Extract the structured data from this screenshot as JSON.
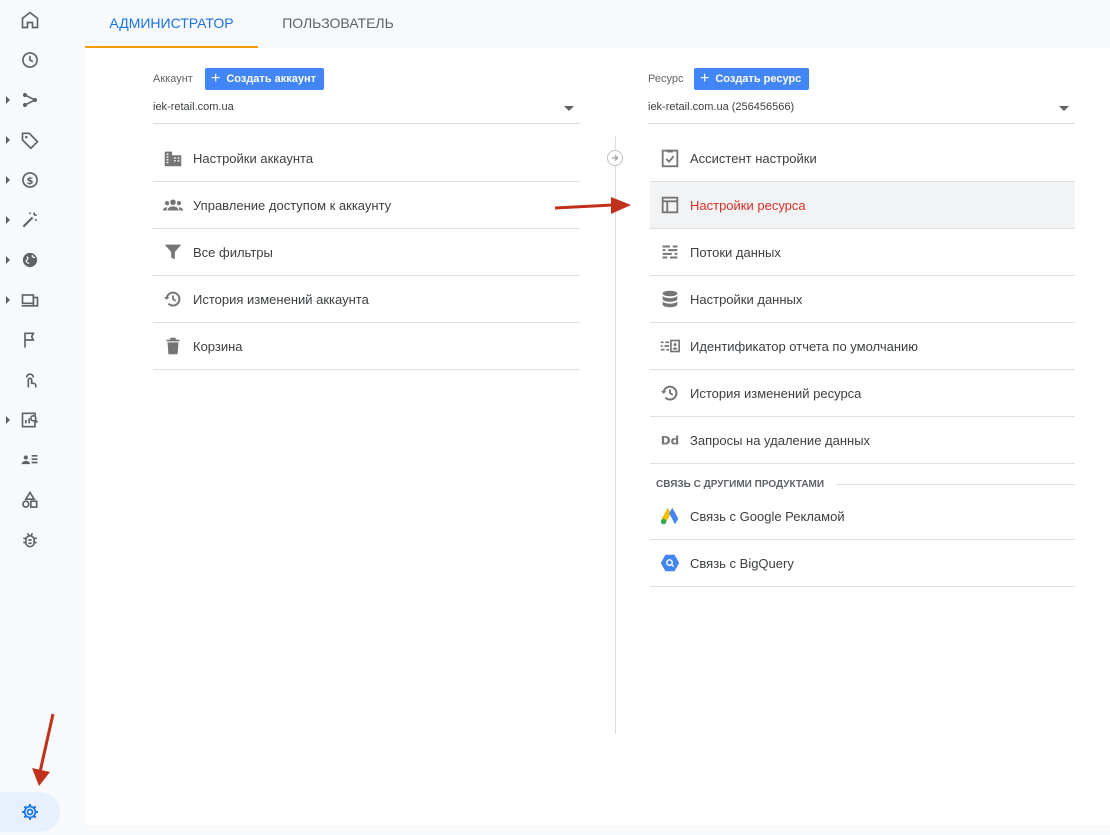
{
  "tabs": {
    "admin": "АДМИНИСТРАТОР",
    "user": "ПОЛЬЗОВАТЕЛЬ"
  },
  "account": {
    "label": "Аккаунт",
    "create_button": "Создать аккаунт",
    "selected": "iek-retail.com.ua",
    "items": [
      {
        "label": "Настройки аккаунта",
        "icon": "building-icon"
      },
      {
        "label": "Управление доступом к аккаунту",
        "icon": "people-icon"
      },
      {
        "label": "Все фильтры",
        "icon": "filter-icon"
      },
      {
        "label": "История изменений аккаунта",
        "icon": "history-icon"
      },
      {
        "label": "Корзина",
        "icon": "trash-icon"
      }
    ]
  },
  "property": {
    "label": "Ресурс",
    "create_button": "Создать ресурс",
    "selected": "iek-retail.com.ua (256456566)",
    "items": [
      {
        "label": "Ассистент настройки",
        "icon": "clipboard-check-icon"
      },
      {
        "label": "Настройки ресурса",
        "icon": "property-layout-icon"
      },
      {
        "label": "Потоки данных",
        "icon": "data-streams-icon"
      },
      {
        "label": "Настройки данных",
        "icon": "database-icon"
      },
      {
        "label": "Идентификатор отчета по умолчанию",
        "icon": "report-id-icon"
      },
      {
        "label": "История изменений ресурса",
        "icon": "history-icon"
      },
      {
        "label": "Запросы на удаление данных",
        "icon": "dd-icon"
      }
    ],
    "links_section": "СВЯЗЬ С ДРУГИМИ ПРОДУКТАМИ",
    "links": [
      {
        "label": "Связь с Google Рекламой",
        "icon": "google-ads-icon"
      },
      {
        "label": "Связь с BigQuery",
        "icon": "bigquery-icon"
      }
    ]
  },
  "colors": {
    "accent": "#1a73e8",
    "tab_underline": "#f29900",
    "button": "#4285f4",
    "highlight_text": "#d93025",
    "annotation_arrow": "#c0311c"
  }
}
